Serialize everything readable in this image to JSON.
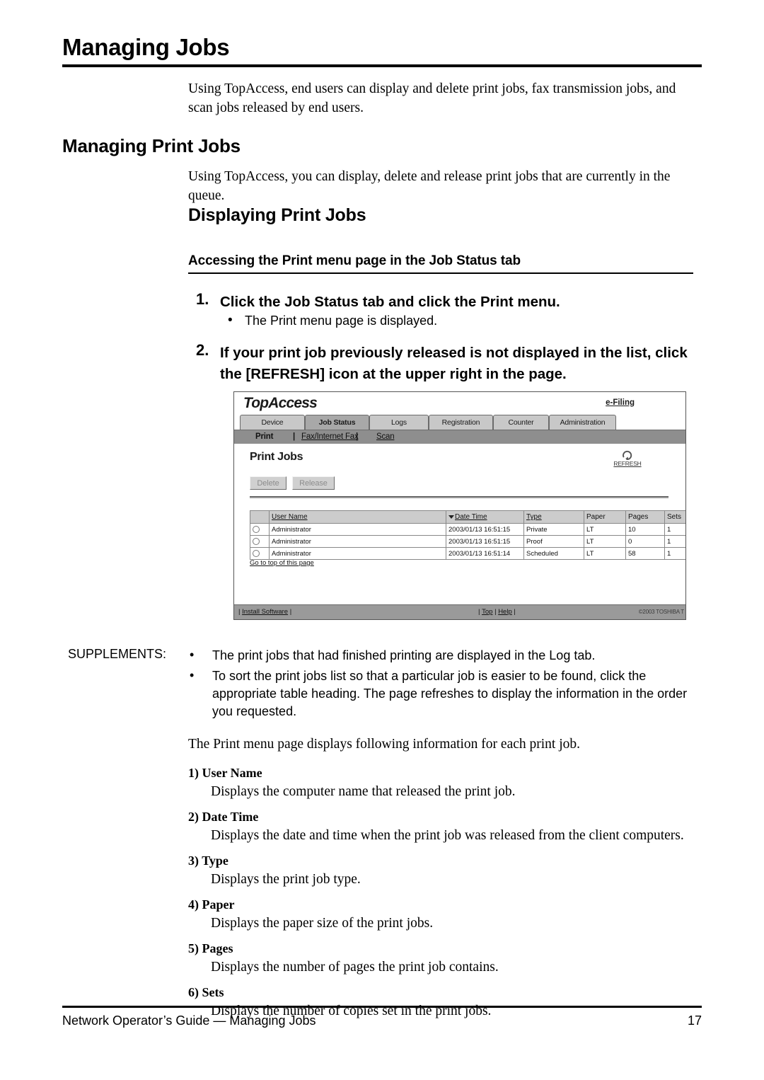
{
  "chapter": {
    "title": "Managing Jobs",
    "intro": "Using TopAccess, end users can display and delete print jobs, fax transmission jobs, and scan jobs released by end users."
  },
  "section": {
    "h2": "Managing Print Jobs",
    "h2_intro": "Using TopAccess, you can display, delete and release print jobs that are currently in the queue.",
    "h3": "Displaying Print Jobs",
    "h4": "Accessing the Print menu page in the Job Status tab"
  },
  "steps": [
    {
      "number": "1.",
      "text": "Click the Job Status tab and click the Print menu.",
      "bullet": "•",
      "sub": "The Print menu page is displayed."
    },
    {
      "number": "2.",
      "text": "If your print job previously released is not displayed in the list, click the [REFRESH] icon at the upper right in the page."
    }
  ],
  "screenshot": {
    "brand": "TopAccess",
    "efiling_link": "e-Filing",
    "tabs": [
      {
        "label": "Device",
        "active": false
      },
      {
        "label": "Job Status",
        "active": true
      },
      {
        "label": "Logs",
        "active": false
      },
      {
        "label": "Registration",
        "active": false
      },
      {
        "label": "Counter",
        "active": false
      },
      {
        "label": "Administration",
        "active": false
      }
    ],
    "subtabs": [
      {
        "label": "Print",
        "active": true
      },
      {
        "label": "Fax/Internet Fax",
        "active": false
      },
      {
        "label": "Scan",
        "active": false
      }
    ],
    "subtab_separator": "|",
    "page_heading": "Print Jobs",
    "refresh_label": "REFRESH",
    "buttons": {
      "delete": "Delete",
      "release": "Release"
    },
    "table": {
      "columns": [
        "User Name",
        "Date Time",
        "Type",
        "Paper",
        "Pages",
        "Sets"
      ],
      "sorted_column": "Date Time",
      "rows": [
        {
          "user": "Administrator",
          "date": "2003/01/13 16:51:15",
          "type": "Private",
          "paper": "LT",
          "pages": "10",
          "sets": "1"
        },
        {
          "user": "Administrator",
          "date": "2003/01/13 16:51:15",
          "type": "Proof",
          "paper": "LT",
          "pages": "0",
          "sets": "1"
        },
        {
          "user": "Administrator",
          "date": "2003/01/13 16:51:14",
          "type": "Scheduled",
          "paper": "LT",
          "pages": "58",
          "sets": "1"
        }
      ]
    },
    "goto_top": "Go to top of this page",
    "footer": {
      "install": "Install Software",
      "top": "Top",
      "help": "Help",
      "copyright": "©2003 TOSHIBA T"
    }
  },
  "supplements": {
    "label": "SUPPLEMENTS:",
    "bullet": "•",
    "items": [
      "The print jobs that had finished printing are displayed in the Log tab.",
      "To sort the print jobs list so that a particular job is easier to be found, click the appropriate table heading. The page refreshes to display the information in the order you requested."
    ]
  },
  "definitions": {
    "intro": "The Print menu page displays following information for each print job.",
    "items": [
      {
        "num": "1)",
        "term": "User Name",
        "desc": "Displays the computer name that released the print job."
      },
      {
        "num": "2)",
        "term": "Date Time",
        "desc": "Displays the date and time when the print job was released from the client computers."
      },
      {
        "num": "3)",
        "term": "Type",
        "desc": "Displays the print job type."
      },
      {
        "num": "4)",
        "term": "Paper",
        "desc": "Displays the paper size of the print jobs."
      },
      {
        "num": "5)",
        "term": "Pages",
        "desc": "Displays the number of pages the print job contains."
      },
      {
        "num": "6)",
        "term": "Sets",
        "desc": "Displays the number of copies set in the print jobs."
      }
    ]
  },
  "page_footer": {
    "text": "Network Operator’s Guide — Managing Jobs",
    "page_number": "17"
  }
}
